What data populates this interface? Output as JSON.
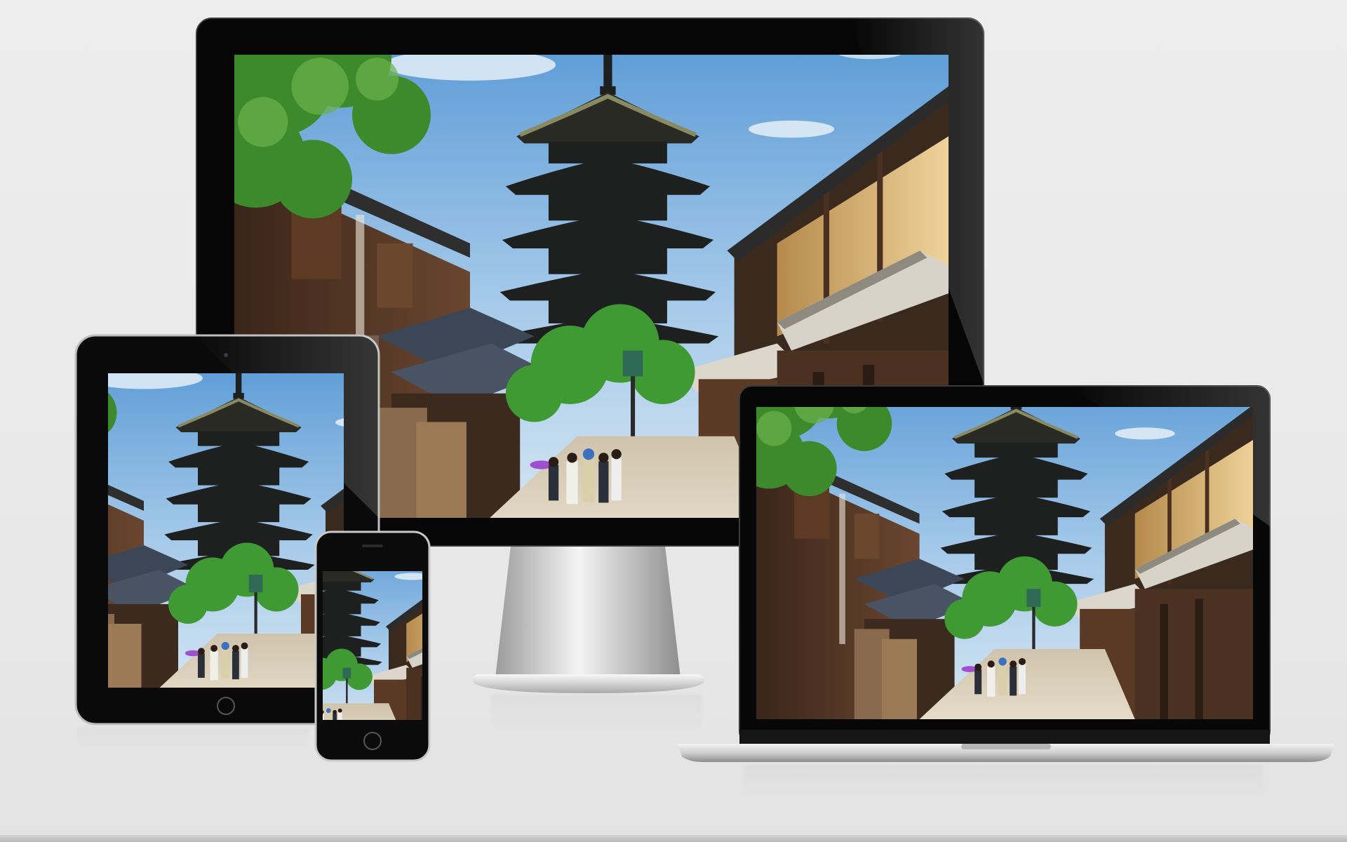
{
  "scene": {
    "description_colors": {
      "background": "#e9e9e9",
      "bezel": "#050505",
      "sky_top": "#5b9bd6",
      "sky_bottom": "#bfdaf0",
      "pagoda": "#1c1d1d",
      "tree": "#3f8f2f",
      "wall_cream": "#e7c98a",
      "wood_dark": "#4a3021",
      "stone_path": "#d8cbb4"
    }
  },
  "devices": [
    {
      "kind": "desktop-monitor",
      "icon": "monitor-icon"
    },
    {
      "kind": "tablet",
      "icon": "tablet-icon"
    },
    {
      "kind": "smartphone",
      "icon": "phone-icon"
    },
    {
      "kind": "laptop",
      "icon": "laptop-icon"
    }
  ]
}
